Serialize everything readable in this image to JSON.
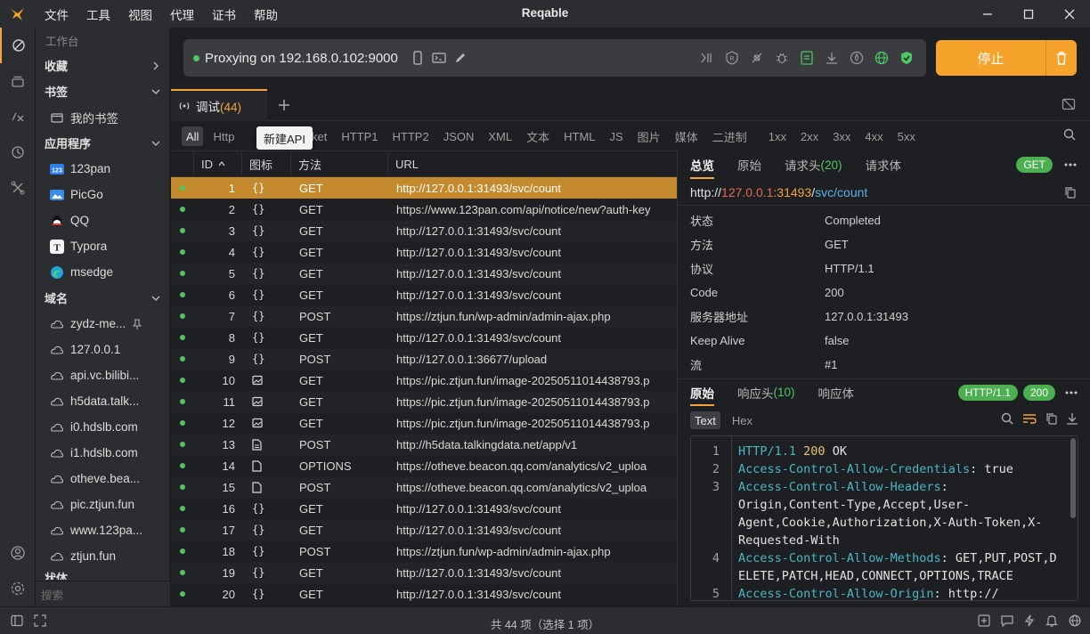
{
  "window": {
    "title": "Reqable"
  },
  "menu": [
    "文件",
    "工具",
    "视图",
    "代理",
    "证书",
    "帮助"
  ],
  "sidebar": {
    "workbench": "工作台",
    "favorites": "收藏",
    "bookmarks": "书签",
    "my_bookmarks": "我的书签",
    "apps_title": "应用程序",
    "apps": [
      "123pan",
      "PicGo",
      "QQ",
      "Typora",
      "msedge"
    ],
    "domains_title": "域名",
    "domains": [
      "zydz-me...",
      "127.0.0.1",
      "api.vc.bilibi...",
      "h5data.talk...",
      "i0.hdslb.com",
      "i1.hdslb.com",
      "otheve.bea...",
      "pic.ztjun.fun",
      "www.123pa...",
      "ztjun.fun"
    ],
    "partial_section": "状体",
    "search_placeholder": "搜索"
  },
  "proxy": {
    "status_text": "Proxying on 192.168.0.102:9000",
    "stop_label": "停止"
  },
  "tabs": {
    "debug_label": "调试",
    "debug_count": "(44)"
  },
  "tooltip": "新建API",
  "filters": [
    "All",
    "Http",
    "ebsocket",
    "HTTP1",
    "HTTP2",
    "JSON",
    "XML",
    "文本",
    "HTML",
    "JS",
    "图片",
    "媒体",
    "二进制",
    "1xx",
    "2xx",
    "3xx",
    "4xx",
    "5xx"
  ],
  "table": {
    "headers": {
      "id": "ID",
      "icon": "图标",
      "method": "方法",
      "url": "URL"
    },
    "rows": [
      {
        "id": "1",
        "type": "json",
        "method": "GET",
        "url": "http://127.0.0.1:31493/svc/count"
      },
      {
        "id": "2",
        "type": "json",
        "method": "GET",
        "url": "https://www.123pan.com/api/notice/new?auth-key"
      },
      {
        "id": "3",
        "type": "json",
        "method": "GET",
        "url": "http://127.0.0.1:31493/svc/count"
      },
      {
        "id": "4",
        "type": "json",
        "method": "GET",
        "url": "http://127.0.0.1:31493/svc/count"
      },
      {
        "id": "5",
        "type": "json",
        "method": "GET",
        "url": "http://127.0.0.1:31493/svc/count"
      },
      {
        "id": "6",
        "type": "json",
        "method": "GET",
        "url": "http://127.0.0.1:31493/svc/count"
      },
      {
        "id": "7",
        "type": "json",
        "method": "POST",
        "url": "https://ztjun.fun/wp-admin/admin-ajax.php"
      },
      {
        "id": "8",
        "type": "json",
        "method": "GET",
        "url": "http://127.0.0.1:31493/svc/count"
      },
      {
        "id": "9",
        "type": "json",
        "method": "POST",
        "url": "http://127.0.0.1:36677/upload"
      },
      {
        "id": "10",
        "type": "image",
        "method": "GET",
        "url": "https://pic.ztjun.fun/image-20250511014438793.p"
      },
      {
        "id": "11",
        "type": "image",
        "method": "GET",
        "url": "https://pic.ztjun.fun/image-20250511014438793.p"
      },
      {
        "id": "12",
        "type": "image",
        "method": "GET",
        "url": "https://pic.ztjun.fun/image-20250511014438793.p"
      },
      {
        "id": "13",
        "type": "doc",
        "method": "POST",
        "url": "http://h5data.talkingdata.net/app/v1"
      },
      {
        "id": "14",
        "type": "file",
        "method": "OPTIONS",
        "url": "https://otheve.beacon.qq.com/analytics/v2_uploa"
      },
      {
        "id": "15",
        "type": "file",
        "method": "POST",
        "url": "https://otheve.beacon.qq.com/analytics/v2_uploa"
      },
      {
        "id": "16",
        "type": "json",
        "method": "GET",
        "url": "http://127.0.0.1:31493/svc/count"
      },
      {
        "id": "17",
        "type": "json",
        "method": "GET",
        "url": "http://127.0.0.1:31493/svc/count"
      },
      {
        "id": "18",
        "type": "json",
        "method": "POST",
        "url": "https://ztjun.fun/wp-admin/admin-ajax.php"
      },
      {
        "id": "19",
        "type": "json",
        "method": "GET",
        "url": "http://127.0.0.1:31493/svc/count"
      },
      {
        "id": "20",
        "type": "json",
        "method": "GET",
        "url": "http://127.0.0.1:31493/svc/count"
      }
    ]
  },
  "detail": {
    "tabs": {
      "summary": "总览",
      "raw": "原始",
      "req_headers": "请求头",
      "req_headers_count": "(20)",
      "req_body": "请求体"
    },
    "method_badge": "GET",
    "url": {
      "scheme": "http://",
      "host": "127.0.0.1",
      "port": ":31493",
      "sep": "/",
      "path": "svc/count"
    },
    "props": [
      {
        "k": "状态",
        "v": "Completed"
      },
      {
        "k": "方法",
        "v": "GET"
      },
      {
        "k": "协议",
        "v": "HTTP/1.1"
      },
      {
        "k": "Code",
        "v": "200"
      },
      {
        "k": "服务器地址",
        "v": "127.0.0.1:31493"
      },
      {
        "k": "Keep Alive",
        "v": "false"
      },
      {
        "k": "流",
        "v": "#1"
      }
    ],
    "resp_tabs": {
      "raw": "原始",
      "headers": "响应头",
      "headers_count": "(10)",
      "body": "响应体"
    },
    "protocol_badge": "HTTP/1.1",
    "code_badge": "200",
    "subtabs": {
      "text": "Text",
      "hex": "Hex"
    },
    "code_lines": [
      {
        "n": "1",
        "text": "HTTP/1.1 200 OK"
      },
      {
        "n": "2",
        "key": "Access-Control-Allow-Credentials",
        "val": ": true"
      },
      {
        "n": "3",
        "key": "Access-Control-Allow-Headers",
        "val": ":"
      },
      {
        "n": "",
        "val": "Origin,Content-Type,Accept,User-"
      },
      {
        "n": "",
        "val": "Agent,Cookie,Authorization,X-Auth-Token,X-"
      },
      {
        "n": "",
        "val": "Requested-With"
      },
      {
        "n": "4",
        "key": "Access-Control-Allow-Methods",
        "val": ": GET,PUT,POST,D"
      },
      {
        "n": "",
        "val": "ELETE,PATCH,HEAD,CONNECT,OPTIONS,TRACE"
      },
      {
        "n": "5",
        "key": "Access-Control-Allow-Origin",
        "val": ": http://"
      }
    ]
  },
  "status": {
    "summary": "共 44 项（选择 1 项）"
  },
  "colors": {
    "accent": "#f5a32b",
    "success": "#4cc764",
    "selected_row": "#c68a2e"
  }
}
